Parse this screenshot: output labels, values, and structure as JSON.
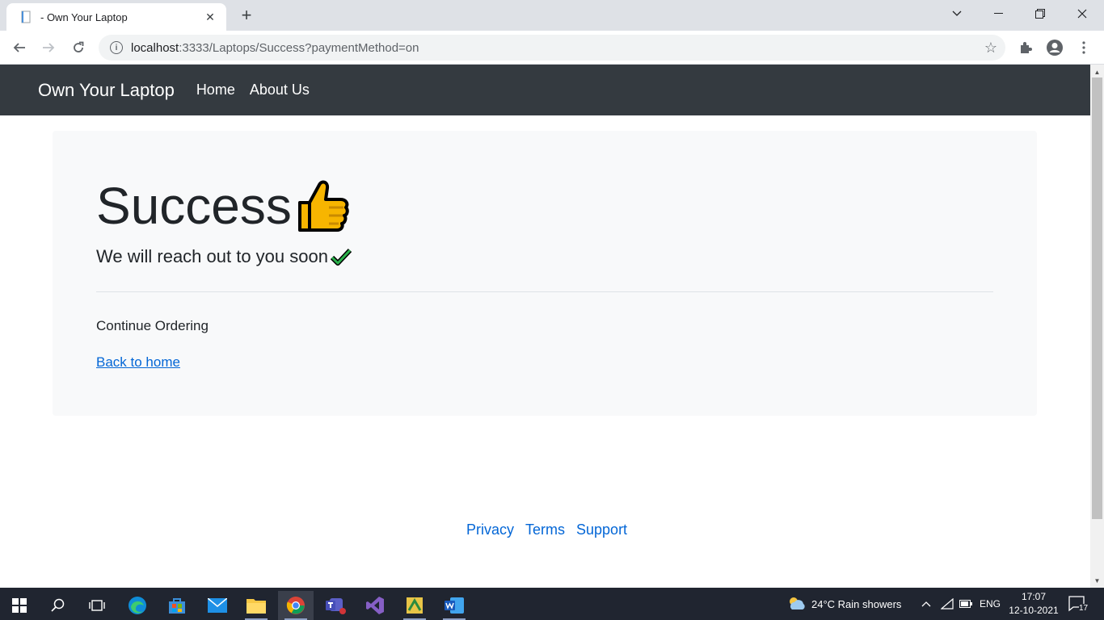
{
  "browser": {
    "tab_title": "- Own Your Laptop",
    "tab_close": "✕",
    "new_tab": "+",
    "url_host": "localhost",
    "url_rest": ":3333/Laptops/Success?paymentMethod=on"
  },
  "navbar": {
    "brand": "Own Your Laptop",
    "links": [
      "Home",
      "About Us"
    ]
  },
  "jumbotron": {
    "title": "Success",
    "lead": "We will reach out to you soon",
    "text": "Continue Ordering",
    "link": "Back to home"
  },
  "footer": {
    "links": [
      "Privacy",
      "Terms",
      "Support"
    ]
  },
  "taskbar": {
    "weather": "24°C  Rain showers",
    "lang": "ENG",
    "time": "17:07",
    "date": "12-10-2021",
    "notifications": "17"
  },
  "colors": {
    "navbar": "#343a40",
    "link": "#0366d6",
    "jumbotron_bg": "#f8f9fa"
  }
}
